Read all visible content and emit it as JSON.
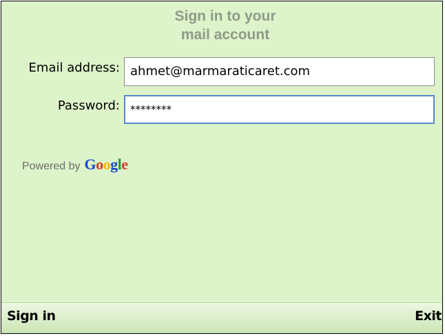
{
  "title": {
    "line1": "Sign in to your",
    "line2": "mail account"
  },
  "form": {
    "email_label": "Email address:",
    "email_value": "ahmet@marmaraticaret.com",
    "password_label": "Password:",
    "password_value": "********"
  },
  "powered_by": {
    "text": "Powered by",
    "logo_letters": [
      "G",
      "o",
      "o",
      "g",
      "l",
      "e"
    ]
  },
  "softkeys": {
    "left": "Sign in",
    "right": "Exit"
  },
  "colors": {
    "background": "#ddf3c9",
    "title": "#8f9a88",
    "focus_border": "#5a86c9"
  }
}
